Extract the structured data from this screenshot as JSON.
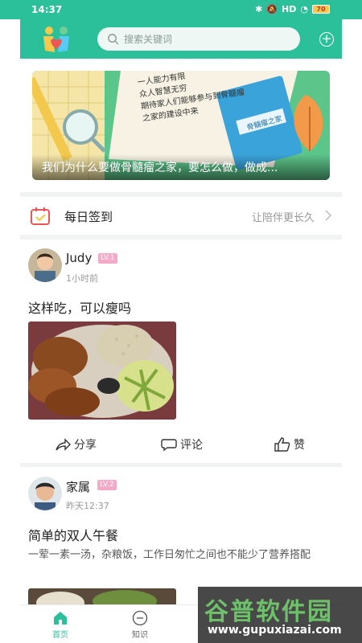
{
  "status_bar": {
    "time": "14:37",
    "battery": "70",
    "network": "HD"
  },
  "header": {
    "search_placeholder": "搜索关键词"
  },
  "banner": {
    "caption": "我们为什么要做骨髓瘤之家，要怎么做，做成...",
    "notebook_lines": [
      "一人能力有限",
      "众人智慧无穷",
      "期待家人们能够参与到骨髓瘤",
      "之家的建设中来"
    ],
    "book_title": "骨髓瘤之家"
  },
  "checkin": {
    "title": "每日签到",
    "subtitle": "让陪伴更长久"
  },
  "posts": [
    {
      "user": "Judy",
      "level": "LV.1",
      "time": "1小时前",
      "title": "这样吃，可以瘦吗",
      "body": "",
      "actions": {
        "share": "分享",
        "comment": "评论",
        "like": "赞"
      }
    },
    {
      "user": "家属",
      "level": "LV.2",
      "time": "昨天12:37",
      "title": "简单的双人午餐",
      "body": "一荤一素一汤，杂粮饭，工作日匆忙之间也不能少了营养搭配"
    }
  ],
  "bottom_nav": [
    {
      "label": "首页",
      "active": true
    },
    {
      "label": "知识",
      "active": false
    }
  ],
  "watermark": {
    "title": "谷普软件园",
    "url": "www.gupuxiazai.com"
  },
  "colors": {
    "brand": "#2bbf9a",
    "level_badge": "#f4a9c6",
    "nav_active": "#2bbf9a"
  }
}
